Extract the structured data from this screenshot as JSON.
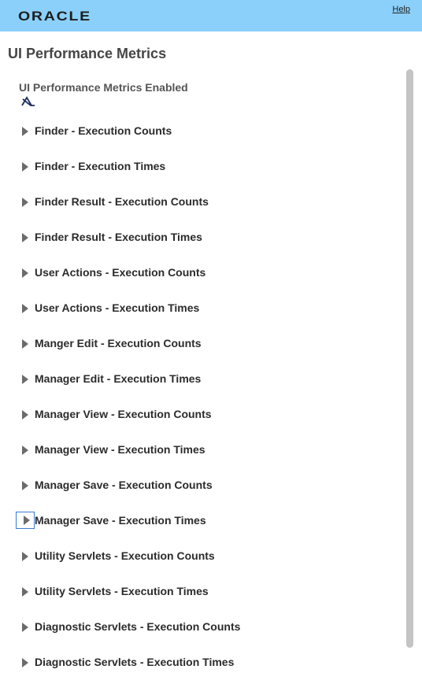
{
  "header": {
    "logo": "ORACLE",
    "help": "Help"
  },
  "page": {
    "title": "UI Performance Metrics",
    "status_label": "UI Performance Metrics Enabled",
    "status_icon": "disabled-checkmark-icon"
  },
  "metrics": [
    {
      "label": "Finder - Execution Counts"
    },
    {
      "label": "Finder - Execution Times"
    },
    {
      "label": "Finder Result - Execution Counts"
    },
    {
      "label": "Finder Result - Execution Times"
    },
    {
      "label": "User Actions - Execution Counts"
    },
    {
      "label": "User Actions - Execution Times"
    },
    {
      "label": "Manger Edit - Execution Counts"
    },
    {
      "label": "Manager Edit - Execution Times"
    },
    {
      "label": "Manager View - Execution Counts"
    },
    {
      "label": "Manager View - Execution Times"
    },
    {
      "label": "Manager Save - Execution Counts"
    },
    {
      "label": "Manager Save - Execution Times"
    },
    {
      "label": "Utility Servlets - Execution Counts"
    },
    {
      "label": "Utility Servlets - Execution Times"
    },
    {
      "label": "Diagnostic Servlets - Execution Counts"
    },
    {
      "label": "Diagnostic Servlets - Execution Times"
    }
  ],
  "colors": {
    "header_bg": "#8bd0fb",
    "focus_ring": "#3b7bd1"
  }
}
